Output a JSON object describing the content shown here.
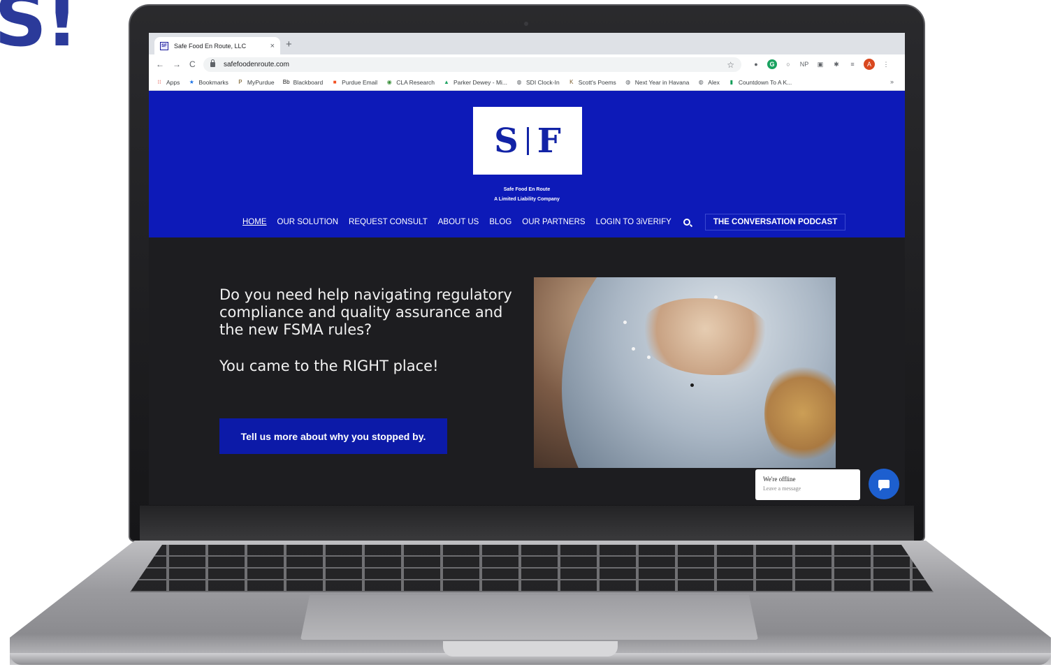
{
  "corner_fragment": "S!",
  "browser": {
    "tab_title": "Safe Food En Route, LLC",
    "tab_close": "×",
    "new_tab": "+",
    "back": "←",
    "forward": "→",
    "reload": "C",
    "url": "safefoodenroute.com",
    "star": "☆",
    "extensions": [
      "●",
      "G",
      "○",
      "NP",
      "▣",
      "✱",
      "≡"
    ],
    "avatar_initial": "A",
    "menu": "⋮",
    "bookmarks": [
      {
        "label": "Apps",
        "icon": "apps-grid-icon",
        "glyph": "⁝⁝",
        "color": "#d93025"
      },
      {
        "label": "Bookmarks",
        "icon": "star-icon",
        "glyph": "★",
        "color": "#1a73e8"
      },
      {
        "label": "MyPurdue",
        "icon": "purdue-icon",
        "glyph": "P",
        "color": "#6b4e16"
      },
      {
        "label": "Blackboard",
        "icon": "blackboard-icon",
        "glyph": "Bb",
        "color": "#222222"
      },
      {
        "label": "Purdue Email",
        "icon": "microsoft-icon",
        "glyph": "■",
        "color": "#f25022"
      },
      {
        "label": "CLA Research",
        "icon": "cla-icon",
        "glyph": "◉",
        "color": "#3a8f3a"
      },
      {
        "label": "Parker Dewey - Mi...",
        "icon": "drive-icon",
        "glyph": "▲",
        "color": "#1fa463"
      },
      {
        "label": "SDI Clock-In",
        "icon": "globe-icon",
        "glyph": "◍",
        "color": "#5f6368"
      },
      {
        "label": "Scott's Poems",
        "icon": "document-icon",
        "glyph": "K",
        "color": "#7a5a2a"
      },
      {
        "label": "Next Year in Havana",
        "icon": "globe-icon",
        "glyph": "◍",
        "color": "#5f6368"
      },
      {
        "label": "Alex",
        "icon": "globe-icon",
        "glyph": "◍",
        "color": "#5f6368"
      },
      {
        "label": "Countdown To A K...",
        "icon": "sheet-icon",
        "glyph": "▮",
        "color": "#0f9d58"
      }
    ],
    "bookmarks_more": "»"
  },
  "site": {
    "logo_left": "S",
    "logo_right": "F",
    "tagline_line1": "Safe Food En Route",
    "tagline_line2": "A Limited Liability Company",
    "nav": [
      "HOME",
      "OUR SOLUTION",
      "REQUEST CONSULT",
      "ABOUT US",
      "BLOG",
      "OUR PARTNERS",
      "LOGIN TO 3iVERIFY"
    ],
    "podcast_label": "THE CONVERSATION PODCAST",
    "colors": {
      "header": "#0d1ab8",
      "hero": "#1d1d20",
      "cta": "#0c1aa8"
    }
  },
  "hero": {
    "headline": "Do you need help navigating regulatory compliance and quality assurance and the new FSMA rules?",
    "subheadline": "You came to the RIGHT place!",
    "cta_label": "Tell us more about why you stopped by."
  },
  "chat": {
    "status": "We're offline",
    "prompt": "Leave a message"
  }
}
